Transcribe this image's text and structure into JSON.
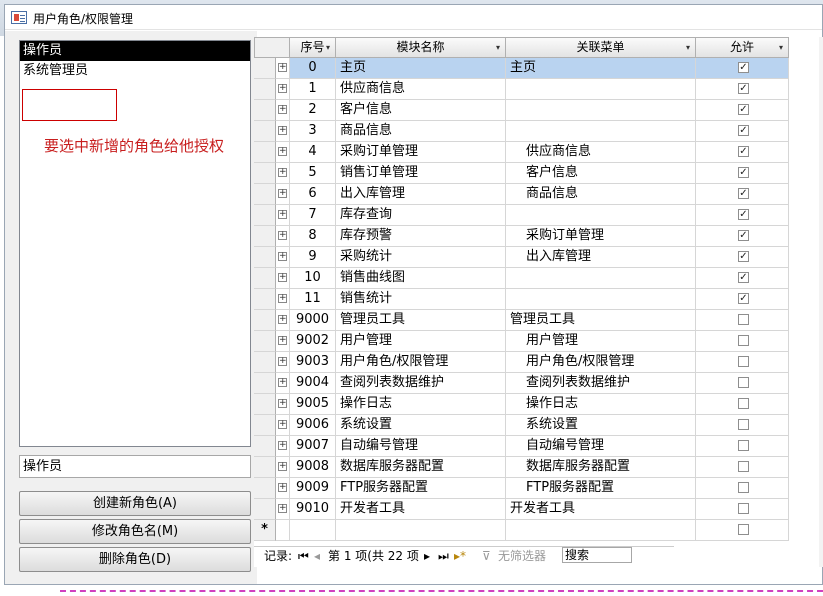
{
  "window": {
    "title": "用户角色/权限管理"
  },
  "roles": {
    "items": [
      "操作员",
      "系统管理员"
    ],
    "selected": 0,
    "annotation": "要选中新增的角色给他授权",
    "name_field_value": "操作员",
    "buttons": [
      "创建新角色(A)",
      "修改角色名(M)",
      "删除角色(D)"
    ]
  },
  "grid": {
    "columns": [
      "序号",
      "模块名称",
      "关联菜单",
      "允许"
    ],
    "rows": [
      {
        "id": "0",
        "module": "主页",
        "menu": "主页",
        "indent": false,
        "allowed": true
      },
      {
        "id": "1",
        "module": "供应商信息",
        "menu": "",
        "indent": false,
        "allowed": true
      },
      {
        "id": "2",
        "module": "客户信息",
        "menu": "",
        "indent": false,
        "allowed": true
      },
      {
        "id": "3",
        "module": "商品信息",
        "menu": "",
        "indent": false,
        "allowed": true
      },
      {
        "id": "4",
        "module": "采购订单管理",
        "menu": "供应商信息",
        "indent": true,
        "allowed": true
      },
      {
        "id": "5",
        "module": "销售订单管理",
        "menu": "客户信息",
        "indent": true,
        "allowed": true
      },
      {
        "id": "6",
        "module": "出入库管理",
        "menu": "商品信息",
        "indent": true,
        "allowed": true
      },
      {
        "id": "7",
        "module": "库存查询",
        "menu": "",
        "indent": false,
        "allowed": true
      },
      {
        "id": "8",
        "module": "库存预警",
        "menu": "采购订单管理",
        "indent": true,
        "allowed": true
      },
      {
        "id": "9",
        "module": "采购统计",
        "menu": "出入库管理",
        "indent": true,
        "allowed": true
      },
      {
        "id": "10",
        "module": "销售曲线图",
        "menu": "",
        "indent": false,
        "allowed": true
      },
      {
        "id": "11",
        "module": "销售统计",
        "menu": "",
        "indent": false,
        "allowed": true
      },
      {
        "id": "9000",
        "module": "管理员工具",
        "menu": "管理员工具",
        "indent": false,
        "allowed": false
      },
      {
        "id": "9002",
        "module": "用户管理",
        "menu": "用户管理",
        "indent": true,
        "allowed": false
      },
      {
        "id": "9003",
        "module": "用户角色/权限管理",
        "menu": "用户角色/权限管理",
        "indent": true,
        "allowed": false
      },
      {
        "id": "9004",
        "module": "查阅列表数据维护",
        "menu": "查阅列表数据维护",
        "indent": true,
        "allowed": false
      },
      {
        "id": "9005",
        "module": "操作日志",
        "menu": "操作日志",
        "indent": true,
        "allowed": false
      },
      {
        "id": "9006",
        "module": "系统设置",
        "menu": "系统设置",
        "indent": true,
        "allowed": false
      },
      {
        "id": "9007",
        "module": "自动编号管理",
        "menu": "自动编号管理",
        "indent": true,
        "allowed": false
      },
      {
        "id": "9008",
        "module": "数据库服务器配置",
        "menu": "数据库服务器配置",
        "indent": true,
        "allowed": false
      },
      {
        "id": "9009",
        "module": "FTP服务器配置",
        "menu": "FTP服务器配置",
        "indent": true,
        "allowed": false
      },
      {
        "id": "9010",
        "module": "开发者工具",
        "menu": "开发者工具",
        "indent": false,
        "allowed": false
      }
    ],
    "new_row_marker": "*"
  },
  "navigator": {
    "label": "记录:",
    "position": "第 1 项(共 22 项",
    "filter": "无筛选器",
    "search": "搜索"
  }
}
